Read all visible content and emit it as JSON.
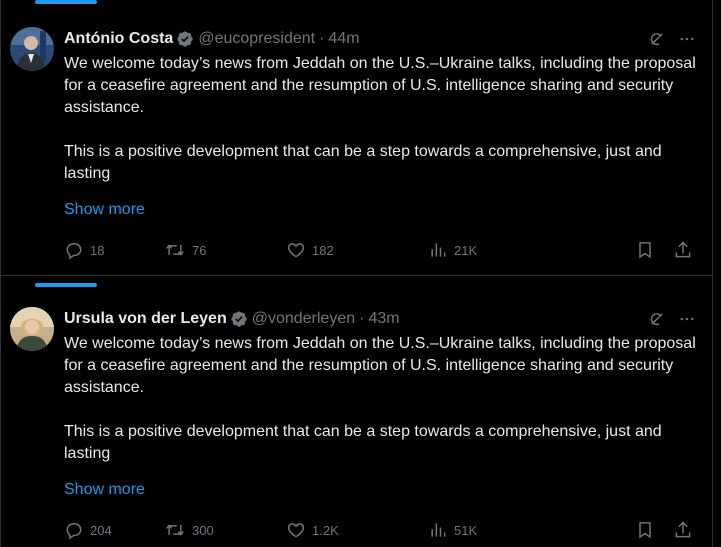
{
  "colors": {
    "background": "#000000",
    "text": "#e7e9ea",
    "muted": "#71767b",
    "accent": "#1d9bf0",
    "divider": "#2f3336"
  },
  "tweets": [
    {
      "author": "António Costa",
      "handle": "@eucopresident",
      "separator": "·",
      "time": "44m",
      "text_p1": "We welcome today’s news from Jeddah on the U.S.–Ukraine talks, including the proposal for a ceasefire agreement and the resumption of U.S. intelligence sharing and security assistance.",
      "text_p2": "This is a positive development that can be a step towards a comprehensive, just and lasting",
      "show_more": "Show more",
      "replies": "18",
      "reposts": "76",
      "likes": "182",
      "views": "21K",
      "avatar_icon": "person-avatar-icon",
      "verified_icon": "verified-badge-icon"
    },
    {
      "author": "Ursula von der Leyen",
      "handle": "@vonderleyen",
      "separator": "·",
      "time": "43m",
      "text_p1": "We welcome today’s news from Jeddah on the U.S.–Ukraine talks, including the proposal for a ceasefire agreement and the resumption of U.S. intelligence sharing and security assistance.",
      "text_p2": "This is a positive development that can be a step towards a comprehensive, just and lasting",
      "show_more": "Show more",
      "replies": "204",
      "reposts": "300",
      "likes": "1.2K",
      "views": "51K",
      "avatar_icon": "person-avatar-icon",
      "verified_icon": "verified-badge-icon"
    }
  ]
}
